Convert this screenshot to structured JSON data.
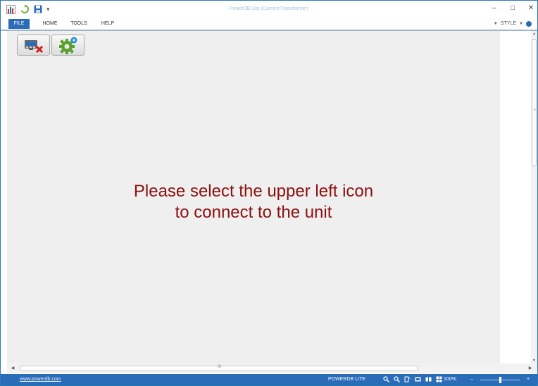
{
  "window": {
    "title": "PowerDB Lite (Current Transformer)",
    "controls": {
      "minimize": "–",
      "maximize": "□",
      "close": "✕"
    }
  },
  "quick_access": {
    "icons": [
      "app-icon",
      "refresh-icon",
      "save-icon"
    ],
    "customize": "▾"
  },
  "ribbon": {
    "tabs": [
      {
        "label": "FILE",
        "active": true
      },
      {
        "label": "HOME",
        "active": false
      },
      {
        "label": "TOOLS",
        "active": false
      },
      {
        "label": "HELP",
        "active": false
      }
    ],
    "style_label": "STYLE"
  },
  "toolbar": {
    "buttons": [
      {
        "icon": "connect-instrument-icon"
      },
      {
        "icon": "settings-gear-icon"
      }
    ]
  },
  "main": {
    "message_line1": "Please select the upper left icon",
    "message_line2": "to connect to the unit"
  },
  "scrollbars": {
    "grip_glyph": "III",
    "vgrip_glyph": "≡"
  },
  "status_bar": {
    "link": "www.powerdb.com",
    "app_name": "POWERDB LITE",
    "zoom": "100%",
    "zoom_minus": "–",
    "zoom_plus": "+"
  },
  "colors": {
    "accent": "#2b6cb8",
    "message": "#8b1010",
    "panel": "#efefef"
  }
}
